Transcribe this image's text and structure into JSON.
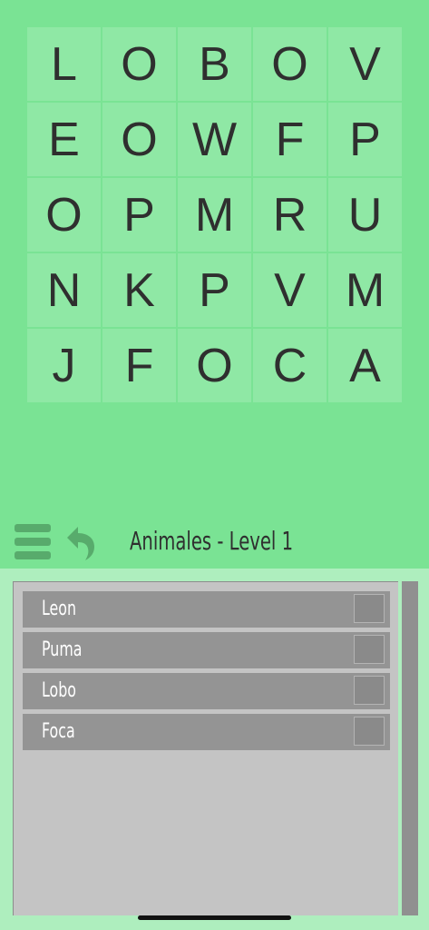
{
  "grid": {
    "rows": [
      [
        "L",
        "O",
        "B",
        "O",
        "V"
      ],
      [
        "E",
        "O",
        "W",
        "F",
        "P"
      ],
      [
        "O",
        "P",
        "M",
        "R",
        "U"
      ],
      [
        "N",
        "K",
        "P",
        "V",
        "M"
      ],
      [
        "J",
        "F",
        "O",
        "C",
        "A"
      ]
    ]
  },
  "toolbar": {
    "menu_icon": "hamburger-menu-icon",
    "undo_icon": "undo-arrow-icon",
    "level_title": "Animales - Level 1"
  },
  "word_list": {
    "words": [
      {
        "label": "Leon",
        "found": false
      },
      {
        "label": "Puma",
        "found": false
      },
      {
        "label": "Lobo",
        "found": false
      },
      {
        "label": "Foca",
        "found": false
      }
    ]
  },
  "colors": {
    "background": "#7ae394",
    "cell": "#8fe8a5",
    "icon": "#58ab6c",
    "panel_area": "#aeeebe",
    "panel": "#c4c4c4",
    "word_row": "#949494"
  }
}
